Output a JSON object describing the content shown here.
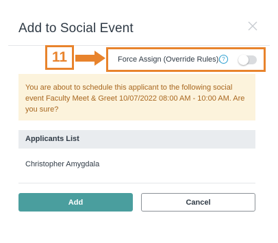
{
  "modal": {
    "title": "Add to Social Event",
    "close_icon": "close-icon"
  },
  "annotation": {
    "step_number": "11",
    "color": "#e8832c"
  },
  "force_assign": {
    "label": "Force Assign (Override Rules):",
    "help_icon": "question-circle-icon",
    "help_glyph": "?",
    "toggle_on": false
  },
  "warning": {
    "message": "You are about to schedule this applicant to the following social event Faculty Meet & Greet 10/07/2022 08:00 AM - 10:00 AM. Are you sure?",
    "background": "#fcf3dc",
    "text_color": "#a8671f"
  },
  "applicants": {
    "header": "Applicants List",
    "items": [
      "Christopher Amygdala"
    ]
  },
  "buttons": {
    "add_label": "Add",
    "cancel_label": "Cancel",
    "add_color": "#4a9e9e"
  }
}
